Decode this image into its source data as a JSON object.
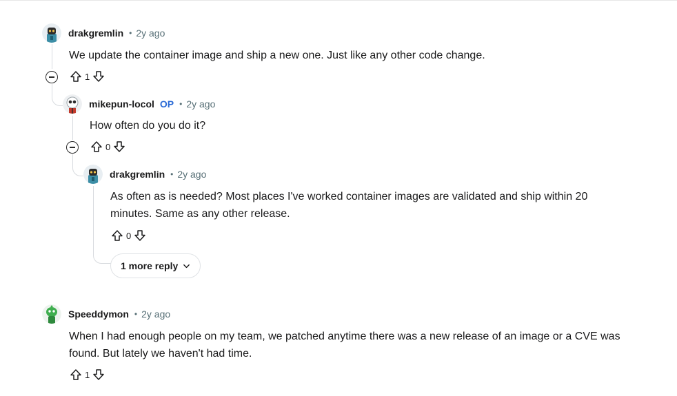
{
  "comments": [
    {
      "username": "drakgremlin",
      "time": "2y ago",
      "separator": "•",
      "body": "We update the container image and ship a new one.  Just like any other code change.",
      "score": "1",
      "avatar_icon": "robot-dark-avatar-icon"
    },
    {
      "username": "mikepun-locol",
      "op_badge": "OP",
      "time": "2y ago",
      "separator": "•",
      "body": "How often do you do it?",
      "score": "0",
      "avatar_icon": "robot-white-avatar-icon"
    },
    {
      "username": "drakgremlin",
      "time": "2y ago",
      "separator": "•",
      "body_line1": "As often as is needed? Most places I've worked container images are validated and ship within 20",
      "body_line2": "minutes. Same as any other release.",
      "score": "0",
      "avatar_icon": "robot-dark-avatar-icon",
      "more_replies": "1 more reply"
    },
    {
      "username": "Speeddymon",
      "time": "2y ago",
      "separator": "•",
      "body_line1": "When I had enough people on my team, we patched anytime there was a new release of an image or a CVE was",
      "body_line2": "found. But lately we haven't had time.",
      "score": "1",
      "avatar_icon": "robot-green-avatar-icon"
    }
  ],
  "colors": {
    "text": "#1a1a1b",
    "meta": "#576f76",
    "op": "#2b6bd6",
    "thread_line": "#d8dbdf"
  }
}
